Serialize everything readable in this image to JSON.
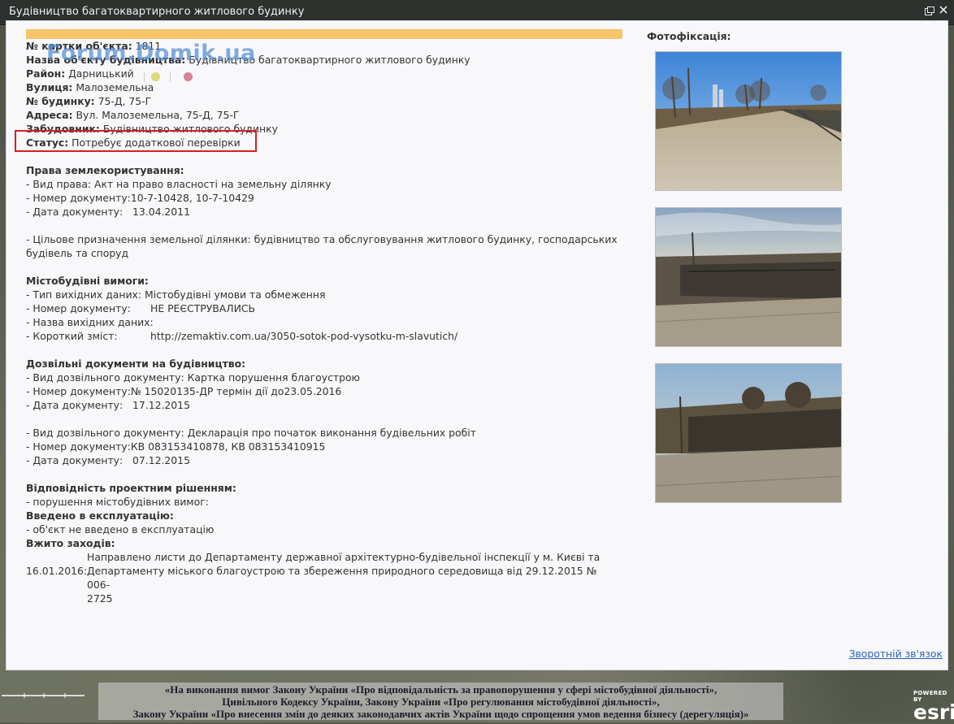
{
  "window": {
    "title": "Будівництво багатоквартирного житлового будинку",
    "maximize_icon": "maximize-icon",
    "close_icon": "close-icon"
  },
  "watermark": "Forum.Domik.ua",
  "info": {
    "card_label": "№ картки об'єкта:",
    "card_value": "1811",
    "name_label": "Назва об'єкту будівництва:",
    "name_value": "Будівництво багатоквартирного житлового будинку",
    "district_label": "Район:",
    "district_value": "Дарницький",
    "street_label": "Вулиця:",
    "street_value": "Малоземельна",
    "house_label": "№ будинку:",
    "house_value": "75-Д, 75-Г",
    "address_label": "Адреса:",
    "address_value": "Вул. Малоземельна, 75-Д, 75-Г",
    "developer_label": "Забудовник:",
    "developer_value": "Будівництво житлового будинку",
    "status_label": "Статус:",
    "status_value": "Потребує додаткової перевірки"
  },
  "status_dots": [
    "#3f8ad0",
    "#dbd978",
    "#d7809a"
  ],
  "land_rights": {
    "title": "Права землекористування:",
    "kind": "- Вид права: Акт на право власності на земельну ділянку",
    "doc_number": "- Номер документу:10-7-10428, 10-7-10429",
    "doc_date": "- Дата документу:   13.04.2011",
    "purpose_line1": "- Цільове призначення земельної ділянки: будівництво та обслуговування житлового будинку, господарських",
    "purpose_line2": "будівель та споруд"
  },
  "urban_requirements": {
    "title": "Містобудівні вимоги:",
    "type": "- Тип вихідних даних: Містобудівні умови та обмеження",
    "number_label": "- Номер документу:",
    "number_value": "НЕ РЕЄСТРУВАЛИСЬ",
    "name": "- Назва вихідних даних:",
    "summary_label": "- Короткий зміст:",
    "summary_value": "http://zemaktiv.com.ua/3050-sotok-pod-vysotku-m-slavutich/"
  },
  "permits": {
    "title": "Дозвільні документи на будівництво:",
    "items": [
      {
        "kind": "- Вид дозвільного документу: Картка порушення благоустрою",
        "number": "- Номер документу:№ 15020135-ДР термін дії до23.05.2016",
        "date": "- Дата документу:   17.12.2015"
      },
      {
        "kind": "- Вид дозвільного документу: Декларація про початок виконання будівельних робіт",
        "number": "- Номер документу:КВ 083153410878, КВ 083153410915",
        "date": "- Дата документу:   07.12.2015"
      }
    ]
  },
  "compliance": {
    "title": "Відповідність проектним рішенням:",
    "value": "- порушення містобудівних вимог:"
  },
  "commissioning": {
    "title": "Введено в експлуатацію:",
    "value": "- об'єкт не введено в експлуатацію"
  },
  "measures": {
    "title": "Вжито заходів:",
    "date": "16.01.2016:",
    "line1": "Направлено листи до Департаменту державної архітектурно-будівельної інспекції у м. Києві та",
    "line2": "Департаменту міського благоустрою та збереження природного середовища від 29.12.2015 № 006-",
    "line3": "2725"
  },
  "photos": {
    "label": "Фотофіксація:"
  },
  "feedback_link": "Зворотній зв'язок",
  "legal_banner": {
    "line1": "«На виконання вимог Закону України «Про відповідальність за правопорушення у сфері містобудівної діяльності»,",
    "line2": "Цивільного Кодексу України, Закону України «Про регулювання містобудівної діяльності»,",
    "line3": "Закону України «Про внесення змін до деяких законодавчих актів України щодо спрощення умов ведення бізнесу (дерегуляція)»"
  },
  "esri": {
    "powered_by": "POWERED BY",
    "brand": "esri"
  }
}
